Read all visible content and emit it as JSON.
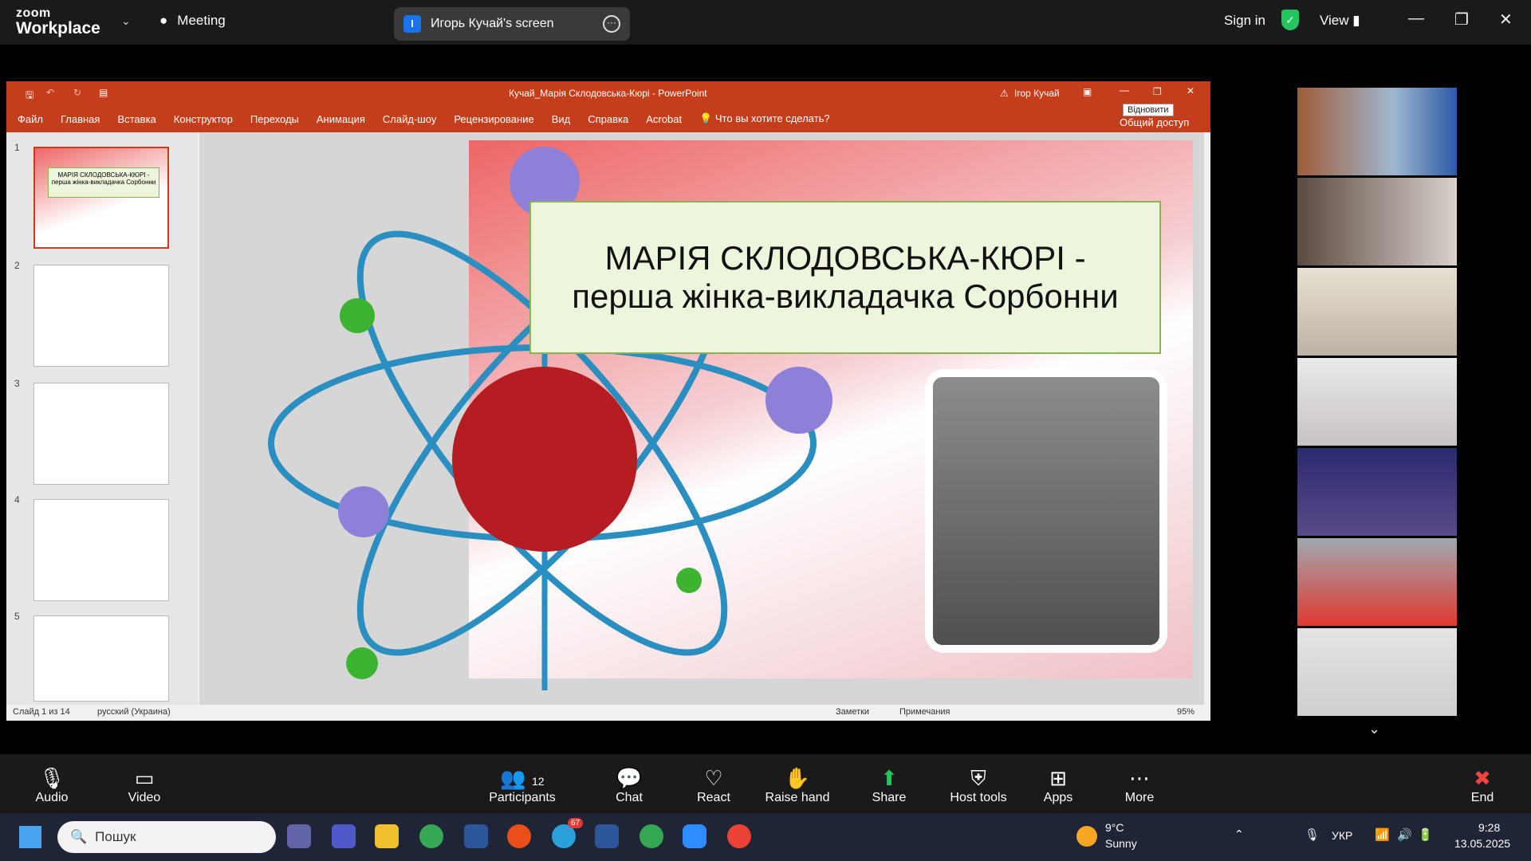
{
  "topbar": {
    "logo_zoom": "zoom",
    "logo_workplace": "Workplace",
    "meeting": "Meeting",
    "screen_label": "Игорь Кучай's screen",
    "signin": "Sign in",
    "view": "View"
  },
  "ppt": {
    "title": "Кучай_Марія Склодовська-Кюрі  -  PowerPoint",
    "user": "Ігор Кучай",
    "menu": [
      "Файл",
      "Главная",
      "Вставка",
      "Конструктор",
      "Переходы",
      "Анимация",
      "Слайд-шоу",
      "Рецензирование",
      "Вид",
      "Справка",
      "Acrobat",
      "Что вы хотите сделать?"
    ],
    "share": "Общий доступ",
    "restore": "Відновити",
    "slide_numbers": [
      "1",
      "2",
      "3",
      "4",
      "5"
    ],
    "slide_title_line1": "МАРІЯ СКЛОДОВСЬКА-КЮРІ -",
    "slide_title_line2": "перша жінка-викладачка Сорбонни",
    "thumb1_title": "МАРІЯ СКЛОДОВСЬКА-КЮРІ - перша жінка-викладачка Сорбонни",
    "status_slide": "Слайд 1 из 14",
    "status_lang": "русский (Украина)",
    "status_notes": "Заметки",
    "status_comments": "Примечания",
    "zoom": "95%"
  },
  "toolbar": {
    "audio": "Audio",
    "video": "Video",
    "participants": "Participants",
    "participants_count": "12",
    "chat": "Chat",
    "react": "React",
    "raise": "Raise hand",
    "share": "Share",
    "host": "Host tools",
    "apps": "Apps",
    "more": "More",
    "end": "End"
  },
  "taskbar": {
    "search": "Пошук",
    "weather_temp": "9°C",
    "weather_desc": "Sunny",
    "lang": "УКР",
    "time": "9:28",
    "date": "13.05.2025",
    "badge": "67"
  }
}
